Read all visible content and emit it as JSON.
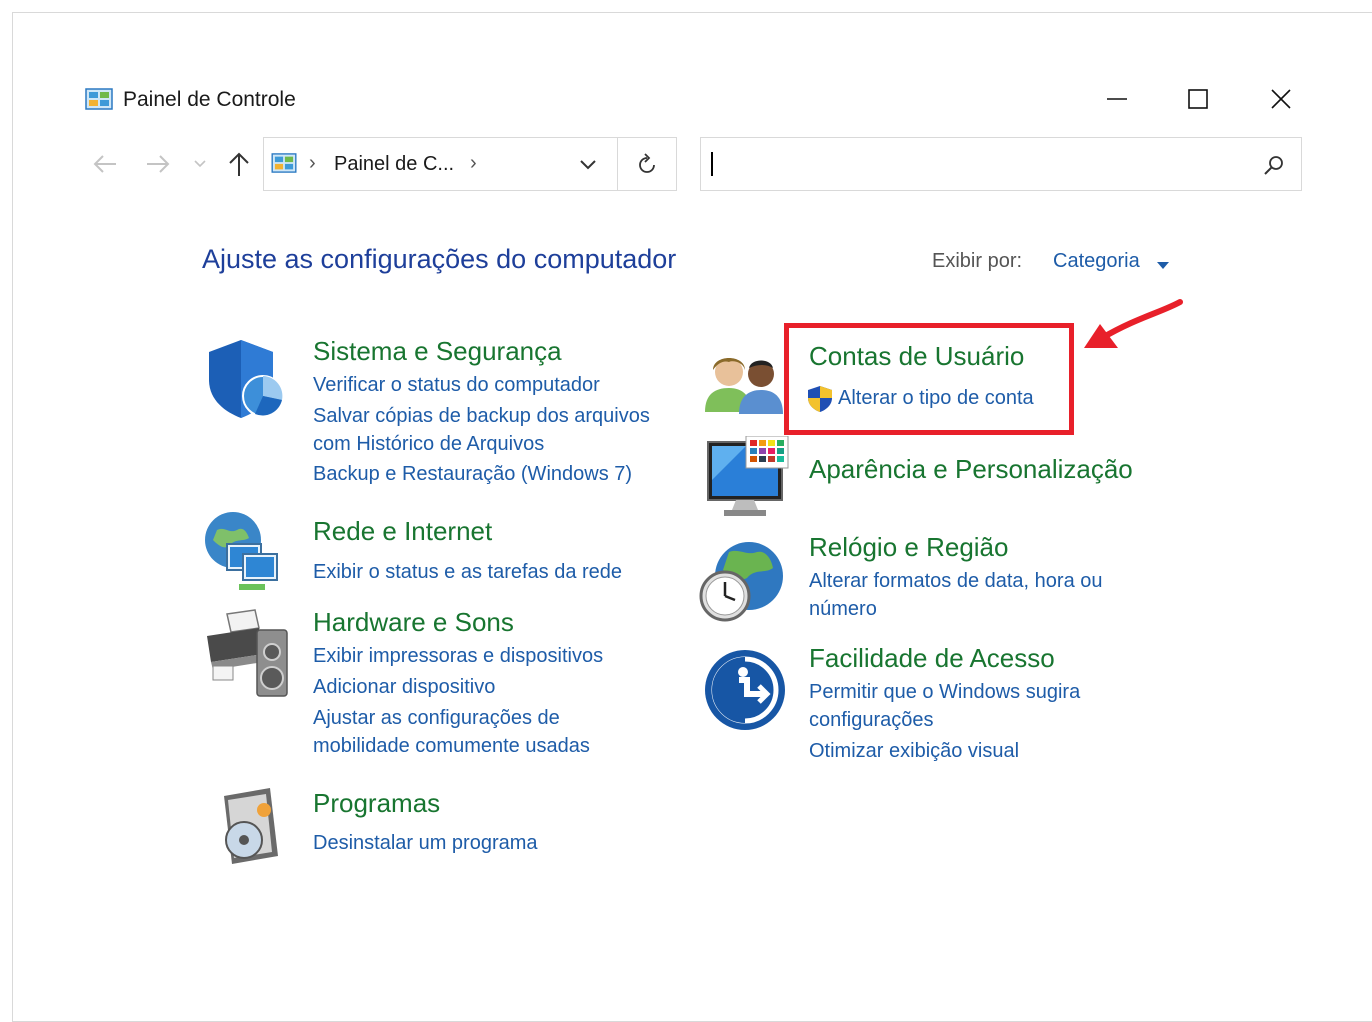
{
  "window": {
    "title": "Painel de Controle",
    "minimize_label": "minimize",
    "maximize_label": "maximize",
    "close_label": "close"
  },
  "address": {
    "arrow_sep": "›",
    "path": "Painel de C...",
    "arrow_after": "›"
  },
  "search": {
    "value": ""
  },
  "main": {
    "heading": "Ajuste as configurações do computador",
    "view_by_label": "Exibir por:",
    "view_by_value": "Categoria"
  },
  "left_categories": [
    {
      "title": "Sistema e Segurança",
      "links": [
        "Verificar o status do computador",
        "Salvar cópias de backup dos arquivos com Histórico de Arquivos",
        "Backup e Restauração (Windows 7)"
      ]
    },
    {
      "title": "Rede e Internet",
      "links": [
        "Exibir o status e as tarefas da rede"
      ]
    },
    {
      "title": "Hardware e Sons",
      "links": [
        "Exibir impressoras e dispositivos",
        "Adicionar dispositivo",
        "Ajustar as configurações de mobilidade comumente usadas"
      ]
    },
    {
      "title": "Programas",
      "links": [
        "Desinstalar um programa"
      ]
    }
  ],
  "right_categories": [
    {
      "title": "Contas de Usuário",
      "links": [
        "Alterar o tipo de conta"
      ]
    },
    {
      "title": "Aparência e Personalização",
      "links": []
    },
    {
      "title": "Relógio e Região",
      "links": [
        "Alterar formatos de data, hora ou número"
      ]
    },
    {
      "title": "Facilidade de Acesso",
      "links": [
        "Permitir que o Windows sugira configurações",
        "Otimizar exibição visual"
      ]
    }
  ],
  "colors": {
    "category_title": "#187530",
    "link": "#1e5ca8",
    "heading": "#1e3f9a",
    "annotation": "#e8202a"
  }
}
